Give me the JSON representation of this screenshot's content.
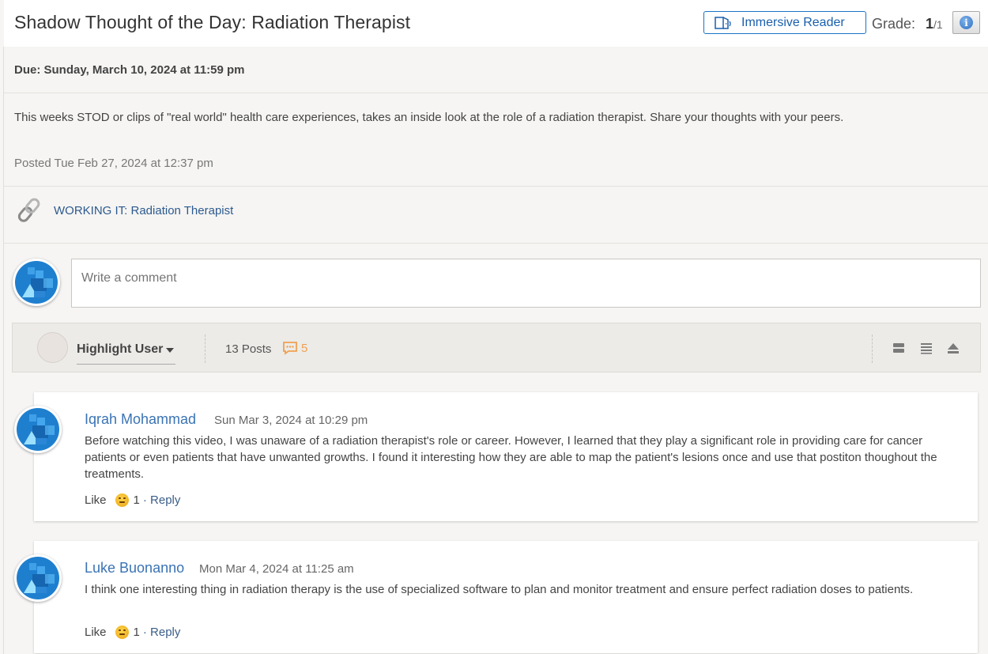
{
  "header": {
    "title": "Shadow Thought of the Day: Radiation Therapist",
    "immersive_reader_label": "Immersive Reader",
    "grade_label": "Grade:",
    "grade_score": "1",
    "grade_total": "/1"
  },
  "assignment": {
    "due": "Due: Sunday, March 10, 2024 at 11:59 pm",
    "description": "This weeks STOD or clips of \"real world\" health care experiences, takes an inside look at the role of a radiation therapist. Share your thoughts with your peers.",
    "posted": "Posted Tue Feb 27, 2024 at 12:37 pm",
    "link_text": "WORKING IT: Radiation Therapist"
  },
  "comment_input": {
    "placeholder": "Write a comment"
  },
  "toolbar": {
    "highlight_user_label": "Highlight User",
    "posts_count": "13 Posts",
    "unread_count": "5",
    "icons": [
      "expand-view-icon",
      "list-view-icon",
      "collapse-view-icon"
    ]
  },
  "posts": [
    {
      "author": "Iqrah Mohammad",
      "date": "Sun Mar 3, 2024 at 10:29 pm",
      "body": "Before watching this video, I was unaware of a radiation therapist's role or career. However, I learned that they play a significant role in providing care for cancer patients or even patients that have unwanted growths. I found it interesting how they are able to map the patient's lesions once and use that postiton thoughout the treatments.",
      "like_label": "Like",
      "like_count": "1",
      "reply_label": "· Reply"
    },
    {
      "author": "Luke Buonanno",
      "date": "Mon Mar 4, 2024 at 11:25 am",
      "body": "I think one interesting thing in radiation therapy is the use of specialized software to plan and monitor treatment and ensure perfect radiation doses to patients.",
      "like_label": "Like",
      "like_count": "1",
      "reply_label": "· Reply"
    }
  ],
  "colors": {
    "accent": "#1a73c8",
    "author_link": "#3a73b4",
    "unread": "#f0a050",
    "avatar_bg": "#1f7fcf"
  }
}
